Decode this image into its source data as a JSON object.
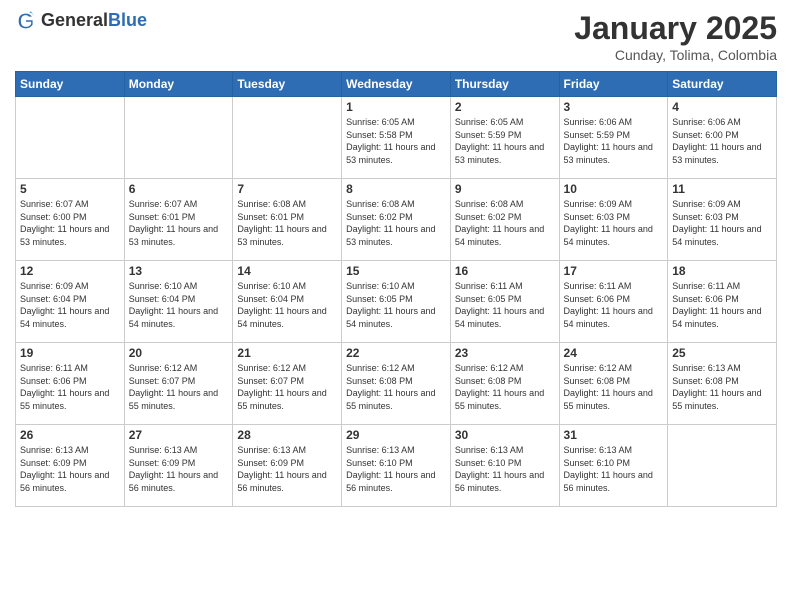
{
  "header": {
    "logo_general": "General",
    "logo_blue": "Blue",
    "title": "January 2025",
    "subtitle": "Cunday, Tolima, Colombia"
  },
  "weekdays": [
    "Sunday",
    "Monday",
    "Tuesday",
    "Wednesday",
    "Thursday",
    "Friday",
    "Saturday"
  ],
  "weeks": [
    [
      {
        "day": "",
        "info": ""
      },
      {
        "day": "",
        "info": ""
      },
      {
        "day": "",
        "info": ""
      },
      {
        "day": "1",
        "info": "Sunrise: 6:05 AM\nSunset: 5:58 PM\nDaylight: 11 hours and 53 minutes."
      },
      {
        "day": "2",
        "info": "Sunrise: 6:05 AM\nSunset: 5:59 PM\nDaylight: 11 hours and 53 minutes."
      },
      {
        "day": "3",
        "info": "Sunrise: 6:06 AM\nSunset: 5:59 PM\nDaylight: 11 hours and 53 minutes."
      },
      {
        "day": "4",
        "info": "Sunrise: 6:06 AM\nSunset: 6:00 PM\nDaylight: 11 hours and 53 minutes."
      }
    ],
    [
      {
        "day": "5",
        "info": "Sunrise: 6:07 AM\nSunset: 6:00 PM\nDaylight: 11 hours and 53 minutes."
      },
      {
        "day": "6",
        "info": "Sunrise: 6:07 AM\nSunset: 6:01 PM\nDaylight: 11 hours and 53 minutes."
      },
      {
        "day": "7",
        "info": "Sunrise: 6:08 AM\nSunset: 6:01 PM\nDaylight: 11 hours and 53 minutes."
      },
      {
        "day": "8",
        "info": "Sunrise: 6:08 AM\nSunset: 6:02 PM\nDaylight: 11 hours and 53 minutes."
      },
      {
        "day": "9",
        "info": "Sunrise: 6:08 AM\nSunset: 6:02 PM\nDaylight: 11 hours and 54 minutes."
      },
      {
        "day": "10",
        "info": "Sunrise: 6:09 AM\nSunset: 6:03 PM\nDaylight: 11 hours and 54 minutes."
      },
      {
        "day": "11",
        "info": "Sunrise: 6:09 AM\nSunset: 6:03 PM\nDaylight: 11 hours and 54 minutes."
      }
    ],
    [
      {
        "day": "12",
        "info": "Sunrise: 6:09 AM\nSunset: 6:04 PM\nDaylight: 11 hours and 54 minutes."
      },
      {
        "day": "13",
        "info": "Sunrise: 6:10 AM\nSunset: 6:04 PM\nDaylight: 11 hours and 54 minutes."
      },
      {
        "day": "14",
        "info": "Sunrise: 6:10 AM\nSunset: 6:04 PM\nDaylight: 11 hours and 54 minutes."
      },
      {
        "day": "15",
        "info": "Sunrise: 6:10 AM\nSunset: 6:05 PM\nDaylight: 11 hours and 54 minutes."
      },
      {
        "day": "16",
        "info": "Sunrise: 6:11 AM\nSunset: 6:05 PM\nDaylight: 11 hours and 54 minutes."
      },
      {
        "day": "17",
        "info": "Sunrise: 6:11 AM\nSunset: 6:06 PM\nDaylight: 11 hours and 54 minutes."
      },
      {
        "day": "18",
        "info": "Sunrise: 6:11 AM\nSunset: 6:06 PM\nDaylight: 11 hours and 54 minutes."
      }
    ],
    [
      {
        "day": "19",
        "info": "Sunrise: 6:11 AM\nSunset: 6:06 PM\nDaylight: 11 hours and 55 minutes."
      },
      {
        "day": "20",
        "info": "Sunrise: 6:12 AM\nSunset: 6:07 PM\nDaylight: 11 hours and 55 minutes."
      },
      {
        "day": "21",
        "info": "Sunrise: 6:12 AM\nSunset: 6:07 PM\nDaylight: 11 hours and 55 minutes."
      },
      {
        "day": "22",
        "info": "Sunrise: 6:12 AM\nSunset: 6:08 PM\nDaylight: 11 hours and 55 minutes."
      },
      {
        "day": "23",
        "info": "Sunrise: 6:12 AM\nSunset: 6:08 PM\nDaylight: 11 hours and 55 minutes."
      },
      {
        "day": "24",
        "info": "Sunrise: 6:12 AM\nSunset: 6:08 PM\nDaylight: 11 hours and 55 minutes."
      },
      {
        "day": "25",
        "info": "Sunrise: 6:13 AM\nSunset: 6:08 PM\nDaylight: 11 hours and 55 minutes."
      }
    ],
    [
      {
        "day": "26",
        "info": "Sunrise: 6:13 AM\nSunset: 6:09 PM\nDaylight: 11 hours and 56 minutes."
      },
      {
        "day": "27",
        "info": "Sunrise: 6:13 AM\nSunset: 6:09 PM\nDaylight: 11 hours and 56 minutes."
      },
      {
        "day": "28",
        "info": "Sunrise: 6:13 AM\nSunset: 6:09 PM\nDaylight: 11 hours and 56 minutes."
      },
      {
        "day": "29",
        "info": "Sunrise: 6:13 AM\nSunset: 6:10 PM\nDaylight: 11 hours and 56 minutes."
      },
      {
        "day": "30",
        "info": "Sunrise: 6:13 AM\nSunset: 6:10 PM\nDaylight: 11 hours and 56 minutes."
      },
      {
        "day": "31",
        "info": "Sunrise: 6:13 AM\nSunset: 6:10 PM\nDaylight: 11 hours and 56 minutes."
      },
      {
        "day": "",
        "info": ""
      }
    ]
  ]
}
